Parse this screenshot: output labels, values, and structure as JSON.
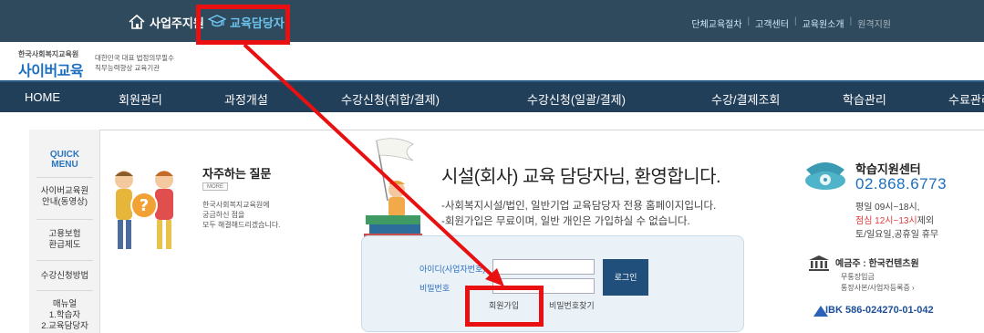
{
  "topbar": {
    "tab_employer": "사업주지원",
    "tab_manager": "교육담당자",
    "links": [
      "단체교육절차",
      "고객센터",
      "교육원소개"
    ],
    "link_dim": "원격지원"
  },
  "logo": {
    "small": "한국사회복지교육원",
    "big": "사이버교육",
    "desc_1": "대한민국 대표 법정의무필수",
    "desc_2": "직무능력향상 교육기관"
  },
  "nav": [
    "HOME",
    "회원관리",
    "과정개설",
    "수강신청(취합/결제)",
    "수강신청(일괄/결제)",
    "수강/결제조회",
    "학습관리",
    "수료관리"
  ],
  "left_menu": {
    "quick_1": "QUICK",
    "quick_2": "MENU",
    "item_1a": "사이버교육원",
    "item_1b": "안내(동영상)",
    "item_2a": "고용보험",
    "item_2b": "환급제도",
    "item_3": "수강신청방법",
    "item_4a": "매뉴얼",
    "item_4b": "1.학습자",
    "item_4c": "2.교육담당자"
  },
  "faq": {
    "title": "자주하는 질문",
    "more": "MORE",
    "desc_1": "한국사회복지교육원에",
    "desc_2": "궁금하신 점을",
    "desc_3": "모두 해결해드리겠습니다."
  },
  "welcome": {
    "title": "시설(회사) 교육 담당자님, 환영합니다.",
    "line_1": "-사회복지시설/법인, 일반기업 교육담당자 전용 홈페이지입니다.",
    "line_2": "-회원가입은 무료이며, 일반 개인은 가입하실 수 없습니다."
  },
  "login": {
    "id_label": "아이디(사업자번호)",
    "pw_label": "비밀번호",
    "id_value": "",
    "pw_value": "",
    "login_button": "로그인",
    "signup_link": "회원가입",
    "find_pw_link": "비밀번호찾기"
  },
  "support": {
    "title": "학습지원센터",
    "phone": "02.868.6773",
    "hours_1": "평일 09시~18시,",
    "lunch": "점심 12시~13시",
    "except": "제외",
    "hours_3": "토/일요일,공휴일 휴무"
  },
  "bank": {
    "title": "예금주 : 한국컨텐츠원",
    "sub_1": "무통장입금",
    "sub_2": "통장사본/사업자등록증 ›",
    "ibk": "IBK",
    "account": "586-024270-01-042"
  },
  "colors": {
    "topbar": "#2f4a5c",
    "nav": "#223f5a",
    "accent_blue": "#1b6fc2",
    "highlight_red": "#e81010"
  },
  "icons": {
    "employer": "home-icon",
    "manager": "graduation-cap-icon",
    "support": "telephone-icon",
    "bank": "bank-icon"
  }
}
